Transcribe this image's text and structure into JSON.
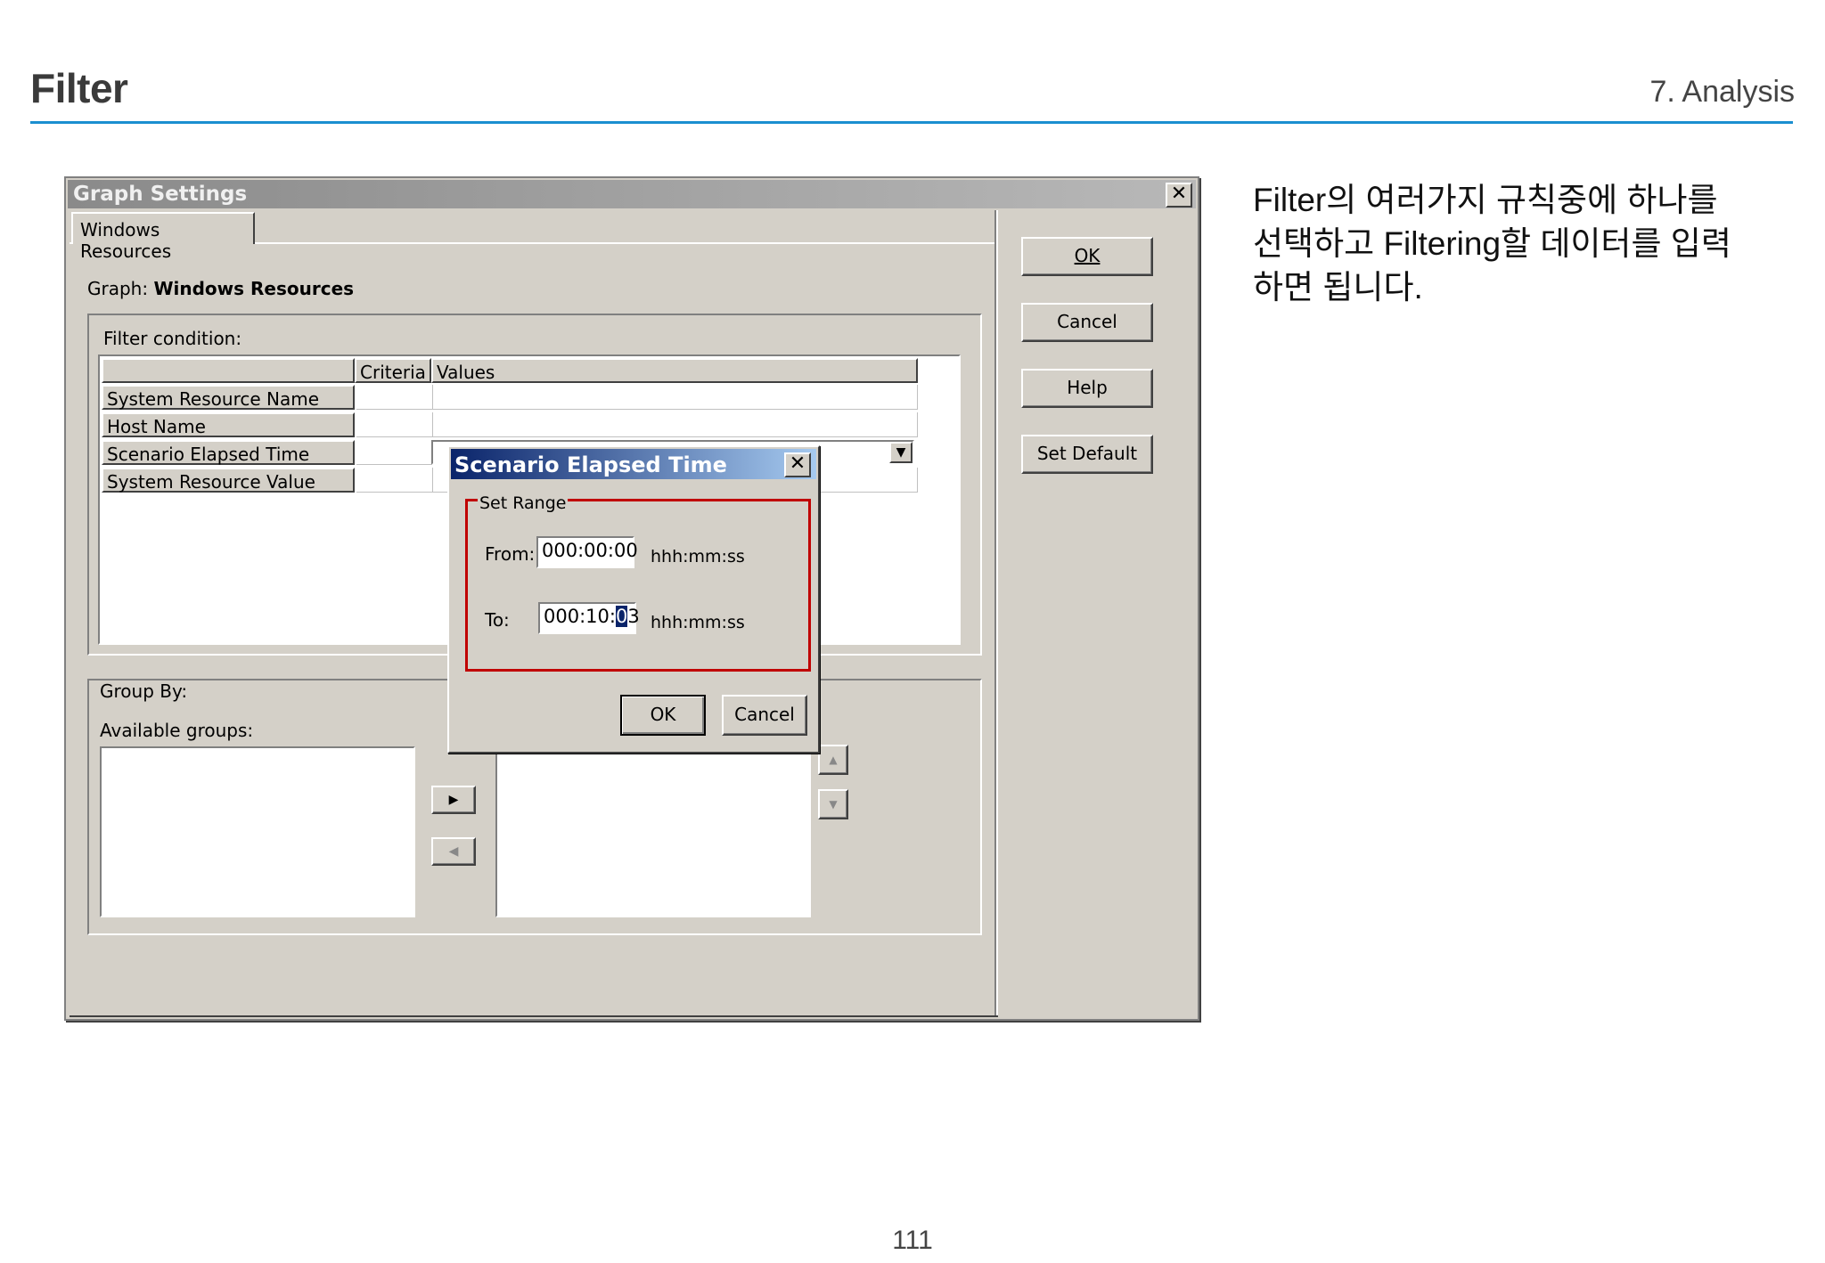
{
  "slide": {
    "title": "Filter",
    "section": "7. Analysis",
    "description": "Filter의 여러가지 규칙중에 하나를 선택하고 Filtering할 데이터를 입력하면 됩니다.",
    "page_number": "111"
  },
  "dialog": {
    "title": "Graph Settings",
    "close_glyph": "✕",
    "tab_label": "Windows Resources",
    "graph_prefix": "Graph:",
    "graph_name": "Windows Resources",
    "filter_condition_label": "Filter condition:",
    "columns": [
      "Criteria",
      "Values"
    ],
    "rows": [
      "System Resource Name",
      "Host Name",
      "Scenario Elapsed Time",
      "System Resource Value"
    ],
    "group_by_label": "Group By:",
    "available_groups_label": "Available groups:",
    "move_right_glyph": "▶",
    "move_left_glyph": "◀",
    "move_up_glyph": "▲",
    "move_down_glyph": "▼",
    "buttons": {
      "ok": "OK",
      "cancel": "Cancel",
      "help": "Help",
      "set_default": "Set Default"
    },
    "combo_glyph": "▼"
  },
  "popup": {
    "title": "Scenario Elapsed Time",
    "close_glyph": "✕",
    "set_range_label": "Set Range",
    "from_label": "From:",
    "from_value": "000:00:00",
    "to_label": "To:",
    "to_value_before_sel": "000:10:",
    "to_value_selected": "0",
    "to_value_after_sel": "3",
    "format_hint": "hhh:mm:ss",
    "ok": "OK",
    "cancel": "Cancel"
  },
  "colors": {
    "rule": "#1b8fd0",
    "highlight_frame": "#c00000",
    "popup_titlebar": "#0a246a"
  }
}
